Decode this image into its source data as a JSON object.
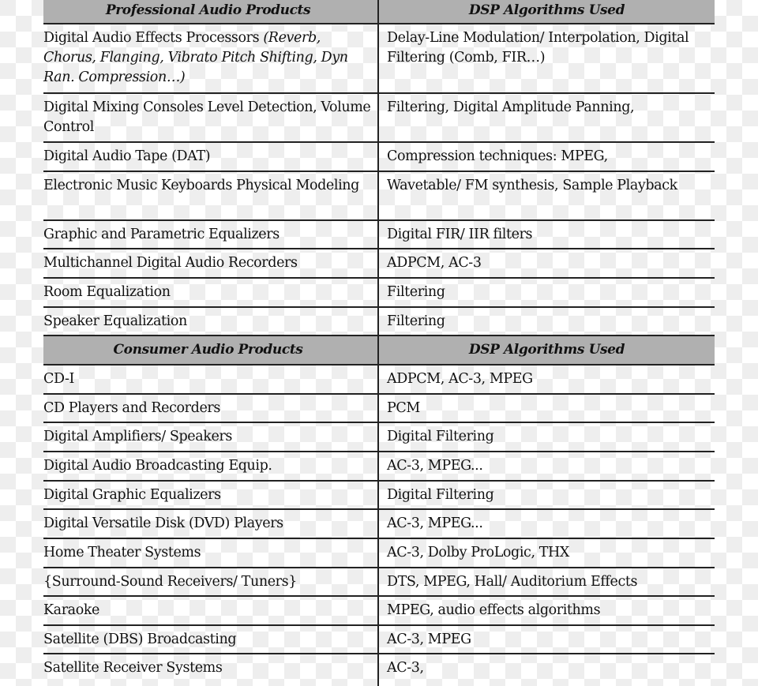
{
  "sections": [
    {
      "header": {
        "product": "Professional Audio Products",
        "algorithms": "DSP Algorithms Used"
      },
      "rows": [
        {
          "product": "Digital Audio Effects Processors ",
          "product_note": "(Reverb, Chorus, Flanging, Vibrato Pitch Shifting, Dyn Ran. Compression…)",
          "algorithms": "Delay-Line Modulation/ Interpolation, Digital Filtering (Comb, FIR…)"
        },
        {
          "product": "Digital Mixing Consoles Level Detection, Volume Control",
          "algorithms": "Filtering, Digital Amplitude Panning,"
        },
        {
          "product": "Digital Audio Tape (DAT)",
          "algorithms": "Compression techniques: MPEG,"
        },
        {
          "product": "Electronic Music Keyboards Physical Modeling",
          "algorithms": "Wavetable/ FM synthesis, Sample Playback"
        },
        {
          "product": "Graphic and Parametric Equalizers",
          "algorithms": "Digital FIR/ IIR filters"
        },
        {
          "product": "Multichannel Digital Audio Recorders",
          "algorithms": "ADPCM, AC-3"
        },
        {
          "product": "Room Equalization",
          "algorithms": "Filtering"
        },
        {
          "product": "Speaker Equalization",
          "algorithms": "Filtering"
        }
      ]
    },
    {
      "header": {
        "product": "Consumer Audio Products",
        "algorithms": "DSP Algorithms Used"
      },
      "rows": [
        {
          "product": "CD-I",
          "algorithms": "ADPCM, AC-3, MPEG"
        },
        {
          "product": "CD Players and Recorders",
          "algorithms": "PCM"
        },
        {
          "product": "Digital Amplifiers/ Speakers",
          "algorithms": "Digital Filtering"
        },
        {
          "product": "Digital Audio Broadcasting Equip.",
          "algorithms": "AC-3, MPEG..."
        },
        {
          "product": "Digital Graphic Equalizers",
          "algorithms": "Digital Filtering"
        },
        {
          "product": "Digital Versatile Disk (DVD) Players",
          "algorithms": "AC-3, MPEG..."
        },
        {
          "product": "Home Theater Systems",
          "algorithms": "AC-3, Dolby ProLogic, THX"
        },
        {
          "product": "{Surround-Sound Receivers/ Tuners}",
          "algorithms": "DTS, MPEG, Hall/ Auditorium Effects"
        },
        {
          "product": "Karaoke",
          "algorithms": "MPEG, audio effects algorithms"
        },
        {
          "product": "Satellite (DBS) Broadcasting",
          "algorithms": "AC-3, MPEG"
        },
        {
          "product": "Satellite Receiver Systems",
          "algorithms": "AC-3,"
        }
      ]
    }
  ]
}
